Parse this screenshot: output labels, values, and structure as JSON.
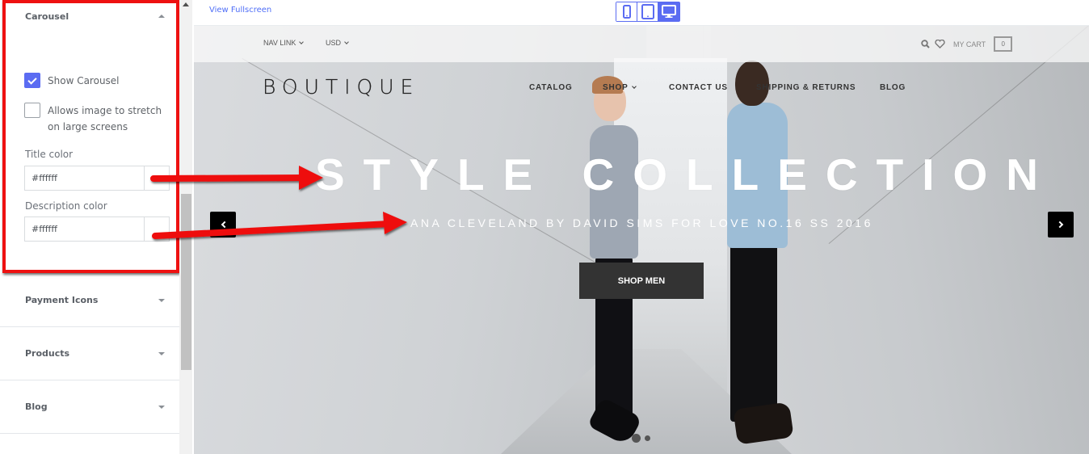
{
  "sidebar": {
    "carousel": {
      "title": "Carousel",
      "show_carousel": {
        "label": "Show Carousel",
        "checked": true
      },
      "stretch": {
        "label": "Allows image to stretch on large screens",
        "checked": false
      },
      "title_color": {
        "label": "Title color",
        "value": "#ffffff"
      },
      "description_color": {
        "label": "Description color",
        "value": "#ffffff"
      }
    },
    "sections": [
      {
        "label": "Payment Icons"
      },
      {
        "label": "Products"
      },
      {
        "label": "Blog"
      }
    ]
  },
  "topbar": {
    "view_fullscreen": "View Fullscreen",
    "devices": [
      {
        "name": "mobile",
        "active": false
      },
      {
        "name": "tablet",
        "active": false
      },
      {
        "name": "desktop",
        "active": true
      }
    ],
    "accent_color": "#5b6cf2"
  },
  "store": {
    "top_nav": {
      "nav_link": "NAV LINK",
      "currency": "USD",
      "my_cart": "MY CART",
      "cart_count": "0"
    },
    "logo": "BOUTIQUE",
    "main_nav": [
      "CATALOG",
      "SHOP",
      "CONTACT US",
      "SHIPPING & RETURNS",
      "BLOG"
    ],
    "hero": {
      "title": "STYLE COLLECTION",
      "description": "ANA CLEVELAND BY DAVID SIMS FOR LOVE NO.16 SS 2016",
      "button": "SHOP MEN",
      "slides": 2,
      "active_slide": 1
    }
  },
  "annotation_color": "#ee1111"
}
